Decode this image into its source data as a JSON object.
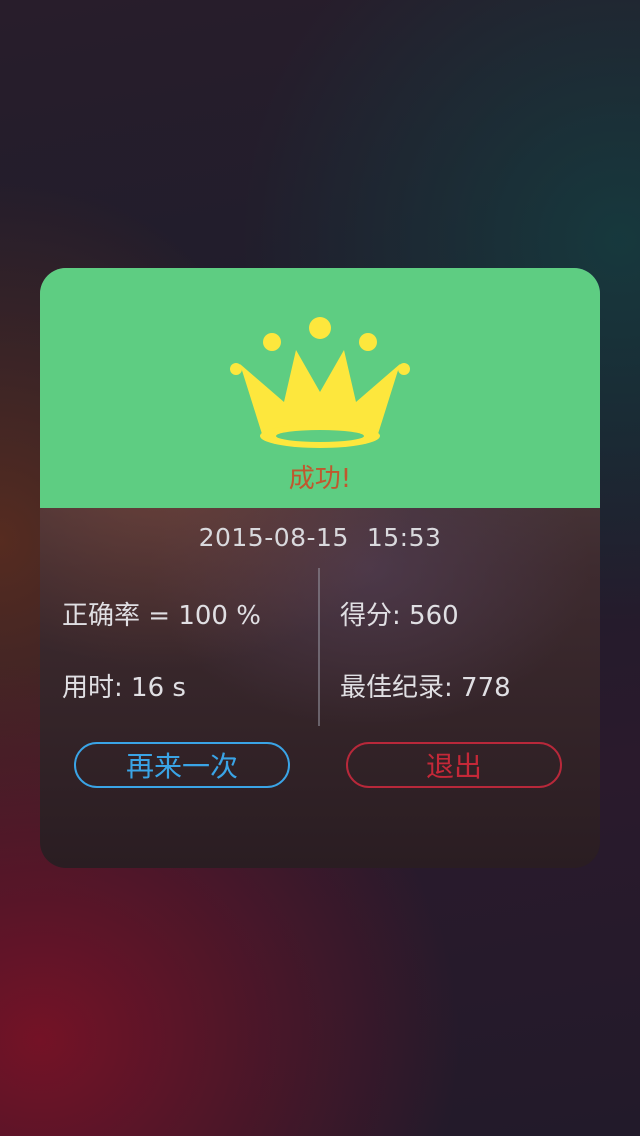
{
  "header": {
    "icon": "crown-icon",
    "title": "成功!",
    "colors": {
      "header_bg": "#5ecd82",
      "crown": "#fde73d",
      "title": "#c0582e"
    }
  },
  "result": {
    "date": "2015-08-15",
    "time": "15:53",
    "accuracy": "正确率 = 100 %",
    "duration": "用时: 16 s",
    "score": "得分: 560",
    "best": "最佳纪录: 778"
  },
  "actions": {
    "retry_label": "再来一次",
    "exit_label": "退出",
    "colors": {
      "retry": "#3aa4e6",
      "exit": "#c42838"
    }
  }
}
